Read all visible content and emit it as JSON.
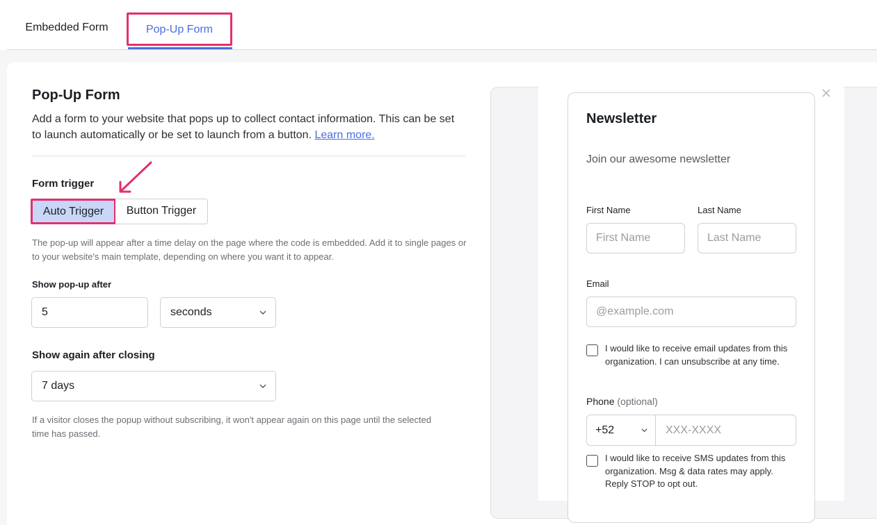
{
  "tabs": {
    "embedded_label": "Embedded Form",
    "popup_label": "Pop-Up Form"
  },
  "settings": {
    "title": "Pop-Up Form",
    "description": "Add a form to your website that pops up to collect contact information. This can be set to launch automatically or be set to launch from a button.",
    "learn_more": "Learn more.",
    "form_trigger_label": "Form trigger",
    "auto_trigger": "Auto Trigger",
    "button_trigger": "Button Trigger",
    "trigger_help": "The pop-up will appear after a time delay on the page where the code is embedded. Add it to single pages or to your website's main template, depending on where you want it to appear.",
    "show_after_label": "Show pop-up after",
    "show_after_value": "5",
    "show_after_unit": "seconds",
    "show_again_label": "Show again after closing",
    "show_again_value": "7 days",
    "show_again_help": "If a visitor closes the popup without subscribing, it won't appear again on this page until the selected time has passed."
  },
  "preview": {
    "title": "Newsletter",
    "subtitle": "Join our awesome newsletter",
    "first_name_label": "First Name",
    "first_name_placeholder": "First Name",
    "last_name_label": "Last Name",
    "last_name_placeholder": "Last Name",
    "email_label": "Email",
    "email_placeholder": "@example.com",
    "email_consent": "I would like to receive email updates from this organization. I can unsubscribe at any time.",
    "phone_label": "Phone",
    "phone_optional": "(optional)",
    "phone_code": "+52",
    "phone_placeholder": "XXX-XXXX",
    "sms_consent": "I would like to receive SMS updates from this organization. Msg & data rates may apply. Reply STOP to opt out."
  },
  "colors": {
    "accent": "#4a6ee0",
    "highlight": "#e3306c",
    "selected_bg": "#c9d6f7"
  },
  "icons": [
    "chevron-down-icon",
    "close-icon",
    "annotation-arrow-icon"
  ]
}
